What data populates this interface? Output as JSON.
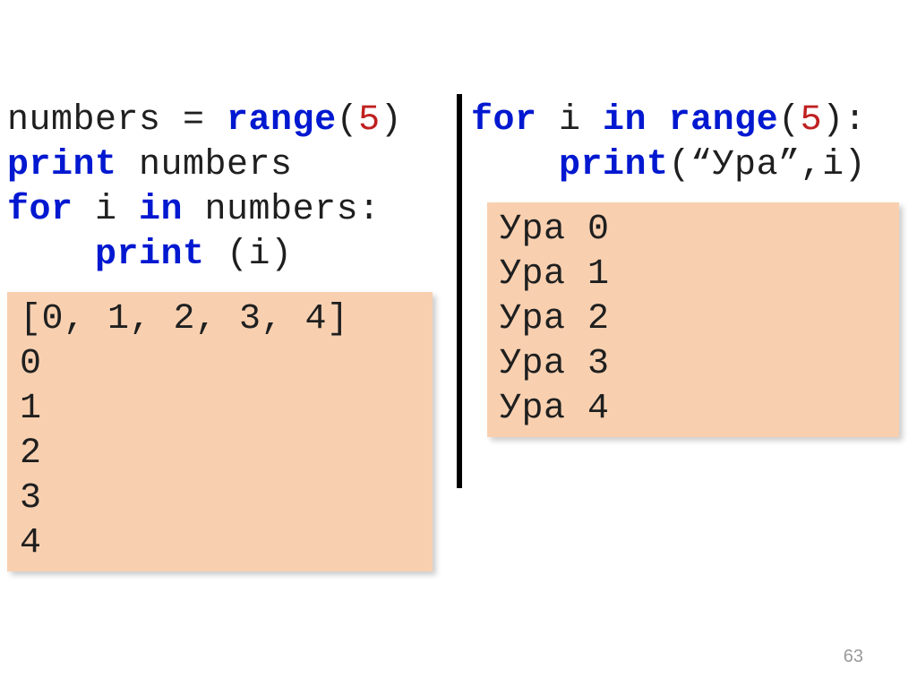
{
  "left": {
    "code": {
      "l1_pre": "numbers = ",
      "l1_kw": "range",
      "l1_open": "(",
      "l1_num": "5",
      "l1_close": ")",
      "l2_kw": "print",
      "l2_rest": " numbers",
      "l3_kw1": "for",
      "l3_mid": " i ",
      "l3_kw2": "in",
      "l3_rest": " numbers:",
      "l4_indent": "    ",
      "l4_kw": "print",
      "l4_rest": " (i)"
    },
    "output": "[0, 1, 2, 3, 4]\n0\n1\n2\n3\n4"
  },
  "right": {
    "code": {
      "l1_kw1": "for",
      "l1_mid": " i ",
      "l1_kw2": "in",
      "l1_sp": " ",
      "l1_kw3": "range",
      "l1_open": "(",
      "l1_num": "5",
      "l1_close": "):",
      "l2_indent": "    ",
      "l2_kw": "print",
      "l2_rest": "(“Ура”,i)"
    },
    "output": "Ура 0\nУра 1\nУра 2\nУра 3\nУра 4"
  },
  "page_number": "63"
}
